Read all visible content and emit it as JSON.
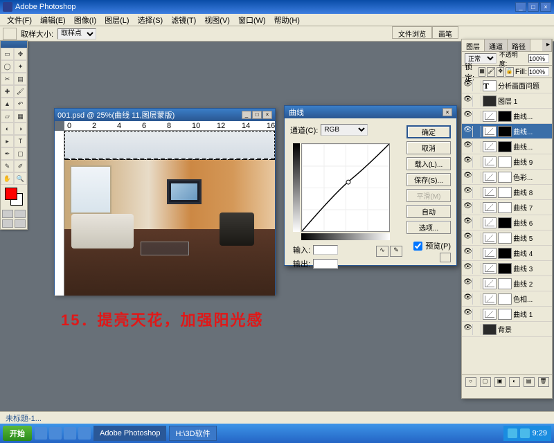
{
  "app": {
    "title": "Adobe Photoshop"
  },
  "menu": [
    "文件(F)",
    "编辑(E)",
    "图像(I)",
    "图层(L)",
    "选择(S)",
    "滤镜(T)",
    "视图(V)",
    "窗口(W)",
    "帮助(H)"
  ],
  "optbar": {
    "label": "取样大小:",
    "value": "取样点"
  },
  "palettetabs": [
    "文件浏览",
    "画笔"
  ],
  "doc": {
    "title": "001.psd @ 25%(曲线 11,图层蒙版)",
    "ruler": [
      "0",
      "2",
      "4",
      "6",
      "8",
      "10",
      "12",
      "14",
      "16"
    ]
  },
  "caption": "15．提亮天花，加强阳光感",
  "curves": {
    "title": "曲线",
    "channel_label": "通道(C):",
    "channel": "RGB",
    "input_label": "输入:",
    "output_label": "输出:",
    "buttons": [
      "确定",
      "取消",
      "载入(L)...",
      "保存(S)...",
      "平滑(M)",
      "自动",
      "选项..."
    ],
    "preview": "预览(P)"
  },
  "layers": {
    "tabs": [
      "图层",
      "通道",
      "路径"
    ],
    "blend": "正常",
    "opac_label": "不透明度:",
    "opac": "100%",
    "lock_label": "锁定:",
    "fill_label": "Fill:",
    "fill": "100%",
    "items": [
      {
        "name": "分析画面问题",
        "type": "text"
      },
      {
        "name": "图层 1",
        "type": "img"
      },
      {
        "name": "曲线...",
        "type": "curve",
        "mask": "d"
      },
      {
        "name": "曲线...",
        "type": "curve",
        "mask": "d",
        "sel": true
      },
      {
        "name": "曲线...",
        "type": "curve",
        "mask": "d"
      },
      {
        "name": "曲线 9",
        "type": "curve",
        "mask": "w"
      },
      {
        "name": "色彩...",
        "type": "adj",
        "mask": "w"
      },
      {
        "name": "曲线 8",
        "type": "curve",
        "mask": "w"
      },
      {
        "name": "曲线 7",
        "type": "curve",
        "mask": "w"
      },
      {
        "name": "曲线 6",
        "type": "curve",
        "mask": "d"
      },
      {
        "name": "曲线 5",
        "type": "curve",
        "mask": "w"
      },
      {
        "name": "曲线 4",
        "type": "curve",
        "mask": "d"
      },
      {
        "name": "曲线 3",
        "type": "curve",
        "mask": "d"
      },
      {
        "name": "曲线 2",
        "type": "curve",
        "mask": "w"
      },
      {
        "name": "色相...",
        "type": "adj",
        "mask": "w"
      },
      {
        "name": "曲线 1",
        "type": "curve",
        "mask": "w"
      },
      {
        "name": "背景",
        "type": "bg"
      }
    ]
  },
  "statusbar": {
    "doc": "未标题-1...",
    "pct": ""
  },
  "taskbar": {
    "start": "开始",
    "tasks": [
      "Adobe Photoshop",
      "H:\\3D软件"
    ],
    "time": "9:29"
  }
}
